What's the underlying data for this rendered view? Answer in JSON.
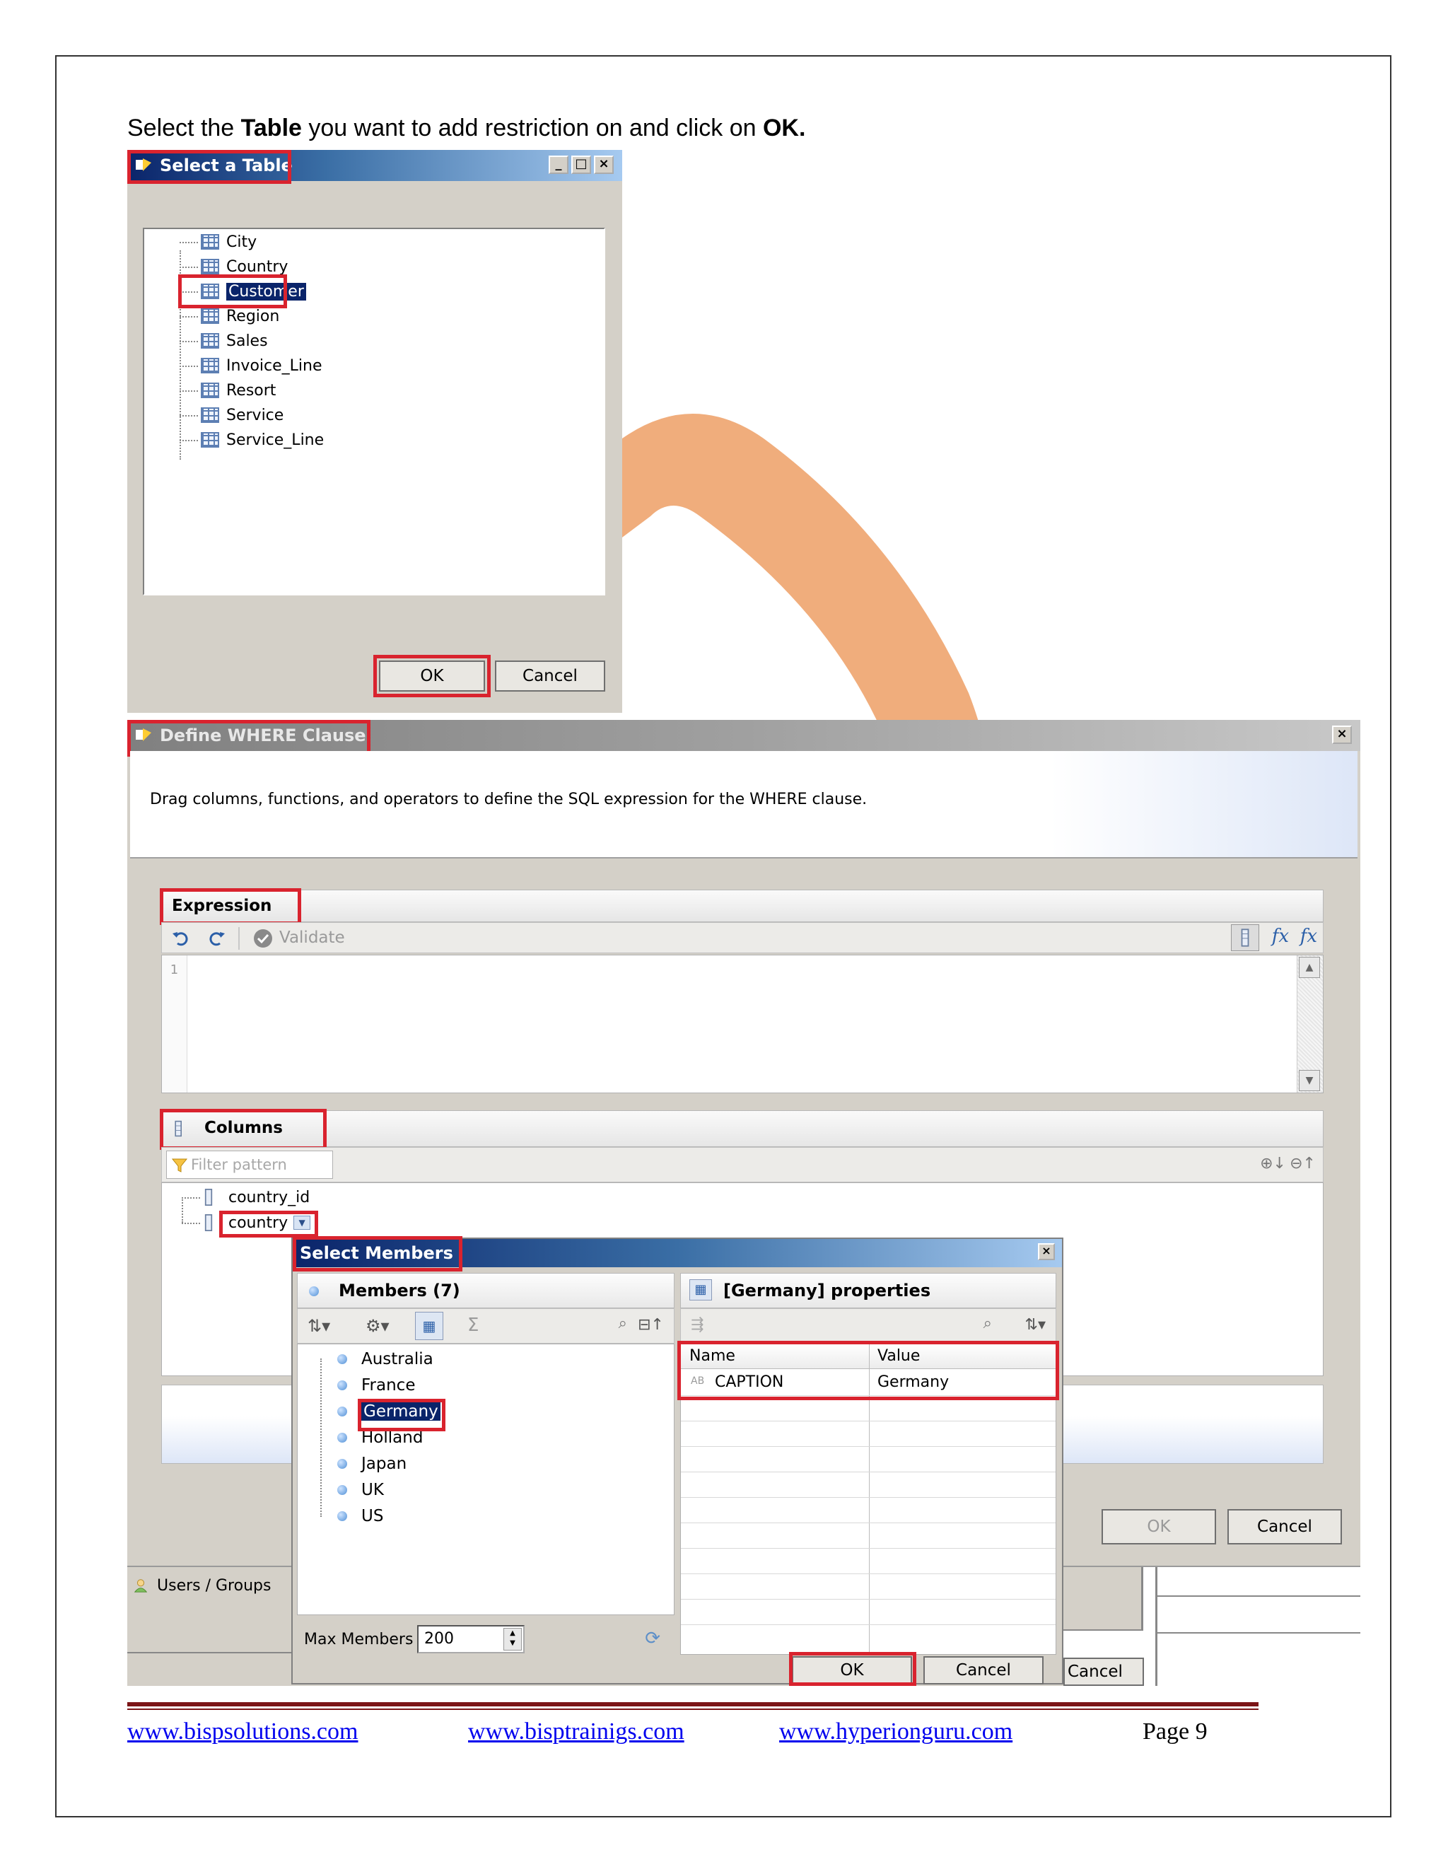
{
  "instruction": {
    "prefix": "Select the ",
    "bold1": "Table",
    "middle": " you want to add restriction on and click on ",
    "bold2": "OK."
  },
  "select_table_dialog": {
    "title": "Select a Table",
    "tables": [
      "City",
      "Country",
      "Customer",
      "Region",
      "Sales",
      "Invoice_Line",
      "Resort",
      "Service",
      "Service_Line"
    ],
    "selected": "Customer",
    "ok_label": "OK",
    "cancel_label": "Cancel"
  },
  "where_dialog": {
    "title": "Define WHERE Clause",
    "description": "Drag columns, functions, and operators to define the SQL expression for the WHERE clause.",
    "expression_header": "Expression",
    "validate_label": "Validate",
    "line_number": "1",
    "columns_header": "Columns",
    "filter_placeholder": "Filter pattern",
    "columns": [
      "country_id",
      "country"
    ],
    "ok_label": "OK",
    "cancel_label": "Cancel",
    "users_groups_label": "Users / Groups",
    "cancel_behind_label": "Cancel"
  },
  "select_members_dialog": {
    "title": "Select Members",
    "members_header": "Members (7)",
    "members": [
      "Australia",
      "France",
      "Germany",
      "Holland",
      "Japan",
      "UK",
      "US"
    ],
    "selected_member": "Germany",
    "properties_header": "[Germany] properties",
    "col_name": "Name",
    "col_value": "Value",
    "prop_type": "AB",
    "prop_name": "CAPTION",
    "prop_value": "Germany",
    "max_members_label": "Max Members",
    "max_members_value": "200",
    "ok_label": "OK",
    "cancel_label": "Cancel"
  },
  "footer": {
    "link1": "www.bispsolutions.com",
    "link2": "www.bisptrainigs.com",
    "link3": "www.hyperionguru.com",
    "page": "Page 9"
  },
  "colors": {
    "highlight_red": "#d9232e",
    "watermark_orange": "#f0ad7c",
    "footer_rule": "#7b1416",
    "link_blue": "#0000ee"
  }
}
